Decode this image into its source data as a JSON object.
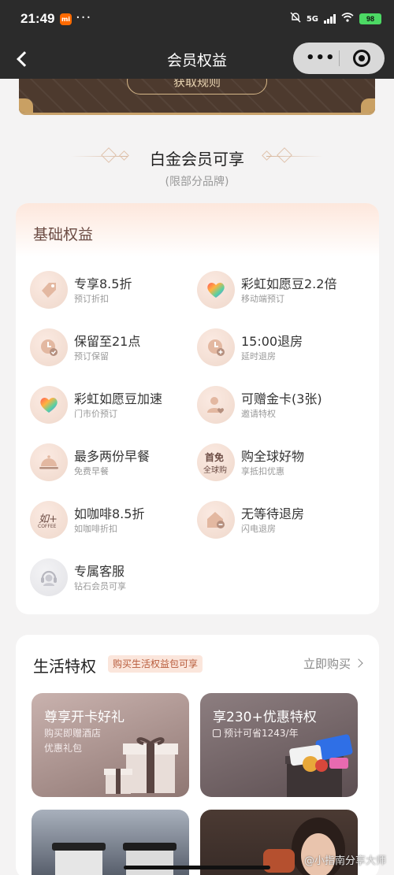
{
  "status": {
    "time": "21:49",
    "mi_label": "mi",
    "dots": "···",
    "network": "5G",
    "battery": "98"
  },
  "nav": {
    "title": "会员权益",
    "more": "•••"
  },
  "banner": {
    "button_label": "获取规则"
  },
  "tier": {
    "title": "白金会员可享",
    "subtitle": "(限部分品牌)"
  },
  "basic": {
    "title": "基础权益",
    "items": [
      {
        "title": "专享8.5折",
        "sub": "预订折扣",
        "icon": "tag-icon"
      },
      {
        "title": "彩虹如愿豆2.2倍",
        "sub": "移动端预订",
        "icon": "rainbow-heart-icon"
      },
      {
        "title": "保留至21点",
        "sub": "预订保留",
        "icon": "clock-check-icon"
      },
      {
        "title": "15:00退房",
        "sub": "延时退房",
        "icon": "clock-plus-icon"
      },
      {
        "title": "彩虹如愿豆加速",
        "sub": "门市价预订",
        "icon": "rainbow-heart-icon"
      },
      {
        "title": "可赠金卡(3张)",
        "sub": "邀请特权",
        "icon": "person-heart-icon"
      },
      {
        "title": "最多两份早餐",
        "sub": "免费早餐",
        "icon": "food-cloche-icon"
      },
      {
        "title": "购全球好物",
        "sub": "享抵扣优惠",
        "icon": "global-shop-icon"
      },
      {
        "title": "如咖啡8.5折",
        "sub": "如咖啡折扣",
        "icon": "coffee-logo-icon"
      },
      {
        "title": "无等待退房",
        "sub": "闪电退房",
        "icon": "house-check-icon"
      },
      {
        "title": "专属客服",
        "sub": "钻石会员可享",
        "icon": "headset-icon"
      }
    ],
    "shop_icon_text_1": "首免",
    "shop_icon_text_2": "全球购",
    "coffee_icon_text": "如+",
    "coffee_icon_sub": "COFFEE"
  },
  "life": {
    "title": "生活特权",
    "badge": "购买生活权益包可享",
    "link": "立即购买",
    "tiles": [
      {
        "title": "尊享开卡好礼",
        "sub1": "购买即赠酒店",
        "sub2": "优惠礼包"
      },
      {
        "title": "享230+优惠特权",
        "sub1": "预计可省1243/年"
      }
    ]
  },
  "watermark": "@小指南分享大师",
  "colors": {
    "nav_bg": "#2b2b2b",
    "accent_brown": "#6b4b43",
    "page_bg": "#f4f3f3"
  }
}
